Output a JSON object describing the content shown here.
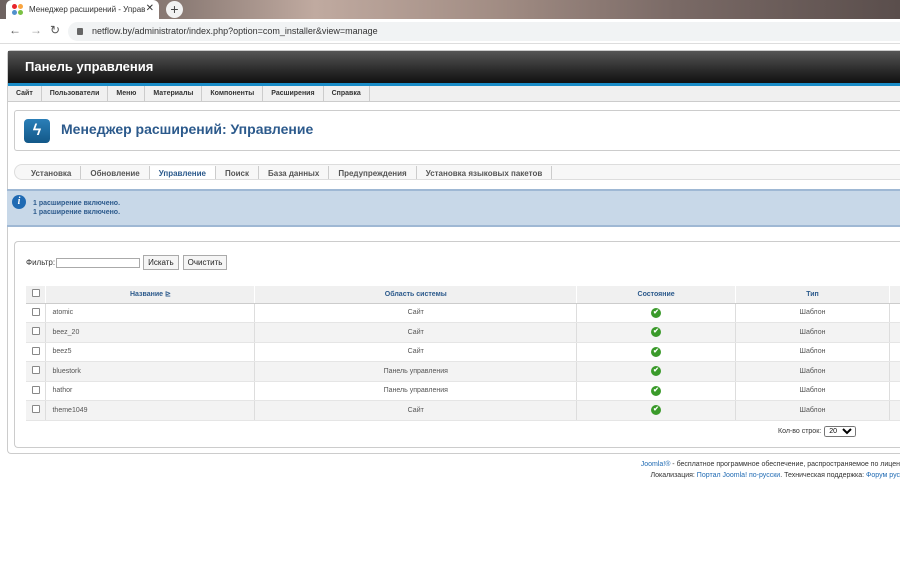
{
  "browser": {
    "tab_title": "Менеджер расширений - Управ",
    "tab_close": "✕",
    "new_tab": "+",
    "url": "netflow.by/administrator/index.php?option=com_installer&view=manage",
    "back_icon": "←",
    "forward_icon": "→",
    "reload_icon": "↻"
  },
  "header": {
    "title": "Панель управления"
  },
  "menu": [
    "Сайт",
    "Пользователи",
    "Меню",
    "Материалы",
    "Компоненты",
    "Расширения",
    "Справка"
  ],
  "page_title": "Менеджер расширений: Управление",
  "page_icon_glyph": "ϟ",
  "subnav": [
    "Установка",
    "Обновление",
    "Управление",
    "Поиск",
    "База данных",
    "Предупреждения",
    "Установка языковых пакетов"
  ],
  "subnav_active": "Управление",
  "messages": [
    "1 расширение включено.",
    "1 расширение включено."
  ],
  "filter": {
    "label": "Фильтр:",
    "value": "",
    "search_button": "Искать",
    "clear_button": "Очистить"
  },
  "table": {
    "columns": [
      "Название",
      "Область системы",
      "Состояние",
      "Тип"
    ],
    "rows": [
      {
        "name": "atomic",
        "area": "Сайт",
        "type": "Шаблон"
      },
      {
        "name": "beez_20",
        "area": "Сайт",
        "type": "Шаблон"
      },
      {
        "name": "beez5",
        "area": "Сайт",
        "type": "Шаблон"
      },
      {
        "name": "bluestork",
        "area": "Панель управления",
        "type": "Шаблон"
      },
      {
        "name": "hathor",
        "area": "Панель управления",
        "type": "Шаблон"
      },
      {
        "name": "theme1049",
        "area": "Сайт",
        "type": "Шаблон"
      }
    ]
  },
  "rows_per_page": {
    "label": "Кол-во строк:",
    "value": "20"
  },
  "footer": {
    "joomla_link": "Joomla!®",
    "line1_rest": " - бесплатное программное обеспечение, распространяемое по лицен",
    "line2_prefix": "Локализация: ",
    "portal_link": "Портал Joomla! по-русски",
    "line2_mid": ". Техническая поддержка: ",
    "forum_link": "Форум рус"
  },
  "colors": {
    "accent": "#2c5a8c",
    "stripe": "#1a8cc7",
    "ok": "#3a9a2a"
  }
}
